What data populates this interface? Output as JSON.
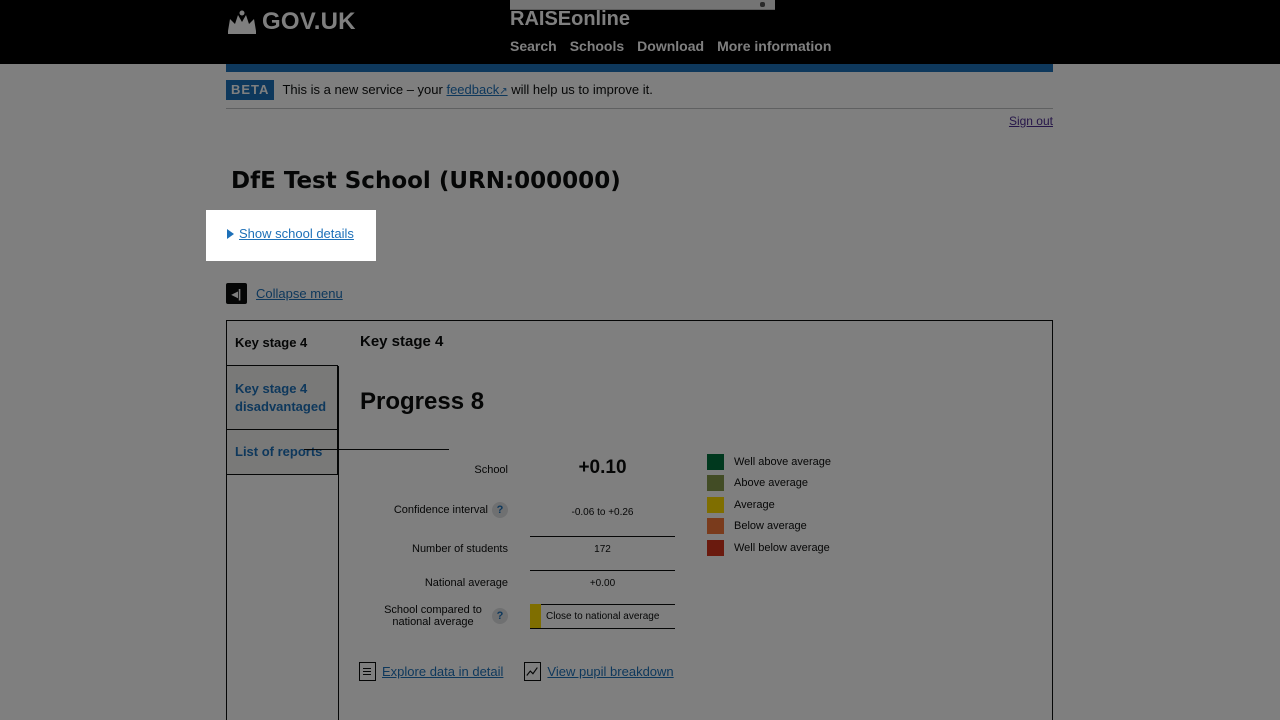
{
  "header": {
    "logo_text": "GOV.UK",
    "service_name": "RAISEonline",
    "nav": [
      "Search",
      "Schools",
      "Download",
      "More information"
    ]
  },
  "beta": {
    "tag": "BETA",
    "text_before": "This is a new service – your ",
    "link": "feedback",
    "text_after": " will help us to improve it."
  },
  "signout": "Sign out",
  "school": {
    "name": "DfE Test School",
    "urn": "(URN:000000)"
  },
  "details_toggle": "Show school details",
  "collapse_menu": "Collapse menu",
  "side_tabs": [
    "Key stage 4",
    "Key stage 4 disadvantaged",
    "List of reports"
  ],
  "content": {
    "section_title": "Key stage 4",
    "heading": "Progress 8",
    "stats": {
      "school_label": "School",
      "school_value": "+0.10",
      "ci_label": "Confidence interval",
      "ci_value": "-0.06 to +0.26",
      "students_label": "Number of students",
      "students_value": "172",
      "national_label": "National average",
      "national_value": "+0.00",
      "compared_label": "School compared to national average",
      "compared_value": "Close to national average"
    },
    "legend": [
      {
        "label": "Well above average",
        "color": "#00703c"
      },
      {
        "label": "Above average",
        "color": "#85994b"
      },
      {
        "label": "Average",
        "color": "#ffdd00"
      },
      {
        "label": "Below average",
        "color": "#f47738"
      },
      {
        "label": "Well below average",
        "color": "#d4351c"
      }
    ],
    "links": [
      "Explore data in detail",
      "View pupil breakdown"
    ]
  }
}
